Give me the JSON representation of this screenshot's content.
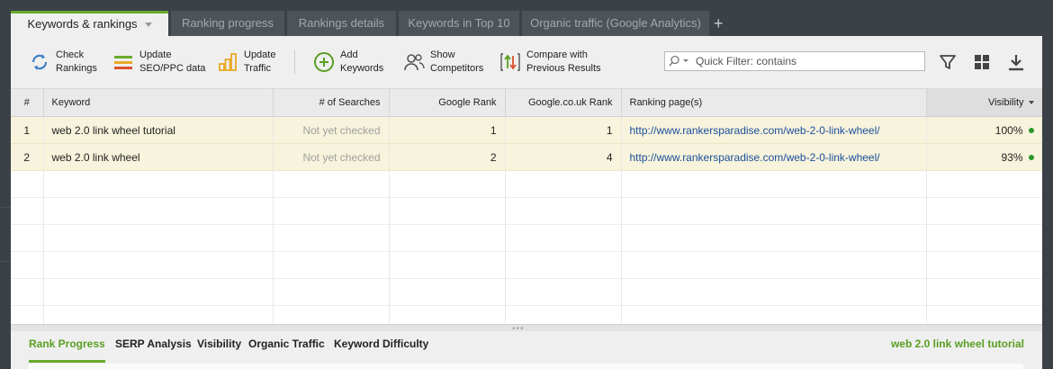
{
  "tabs": [
    {
      "label": "Keywords & rankings",
      "active": true
    },
    {
      "label": "Ranking progress",
      "active": false
    },
    {
      "label": "Rankings details",
      "active": false
    },
    {
      "label": "Keywords in Top 10",
      "active": false
    },
    {
      "label": "Organic traffic (Google Analytics)",
      "active": false
    }
  ],
  "new_tab_label": "+",
  "toolbar": {
    "check_rankings": "Check\nRankings",
    "update_seo": "Update\nSEO/PPC data",
    "update_traffic": "Update\nTraffic",
    "add_keywords": "Add\nKeywords",
    "show_competitors": "Show\nCompetitors",
    "compare_results": "Compare with\nPrevious Results",
    "filter_placeholder": "Quick Filter: contains",
    "icons": [
      "refresh-icon",
      "bars-icon",
      "bar-chart-icon",
      "add-circle-icon",
      "users-icon",
      "compare-arrows-icon",
      "search-icon",
      "filter-icon",
      "grid-icon",
      "download-icon"
    ]
  },
  "table": {
    "columns": [
      "#",
      "Keyword",
      "# of Searches",
      "Google Rank",
      "Google.co.uk Rank",
      "Ranking page(s)",
      "Visibility"
    ],
    "rows": [
      {
        "num": "1",
        "keyword": "web 2.0 link wheel tutorial",
        "searches": "Not yet checked",
        "google_rank": "1",
        "google_uk_rank": "1",
        "page": "http://www.rankersparadise.com/web-2-0-link-wheel/",
        "visibility": "100%"
      },
      {
        "num": "2",
        "keyword": "web 2.0 link wheel",
        "searches": "Not yet checked",
        "google_rank": "2",
        "google_uk_rank": "4",
        "page": "http://www.rankersparadise.com/web-2-0-link-wheel/",
        "visibility": "93%"
      }
    ]
  },
  "bottom": {
    "tabs": [
      "Rank Progress",
      "SERP Analysis",
      "Visibility",
      "Organic Traffic",
      "Keyword Difficulty"
    ],
    "active_tab": "Rank Progress",
    "selected_keyword": "web 2.0 link wheel tutorial"
  },
  "colors": {
    "accent": "#6aaa2c",
    "link": "#1b4f9c",
    "row_highlight": "#f7f3dc",
    "status_dot": "#2a9a2a"
  }
}
